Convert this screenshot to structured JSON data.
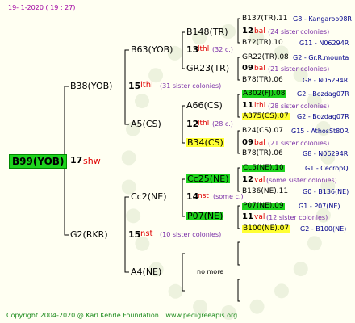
{
  "header": {
    "date": "19-  1-2020  ( 19 : 27)"
  },
  "footer": {
    "copyright": "Copyright 2004-2020 @ Karl Kehrle Foundation",
    "site": "www.pedigreeapis.org"
  },
  "root": {
    "name": "B99(YOB)",
    "gen": "17",
    "origin": "shw"
  },
  "g1": [
    {
      "name": "B38(YOB)",
      "gen": "15",
      "origin": "lthl",
      "note": "(31 sister colonies)"
    },
    {
      "name": "G2(RKR)",
      "gen": "15",
      "origin": "nst",
      "note": "(10 sister colonies)"
    }
  ],
  "g2": [
    {
      "name": "B63(YOB)",
      "gen": "13",
      "origin": "lthl",
      "note": "(32 c.)"
    },
    {
      "name": "A5(CS)",
      "gen": "12",
      "origin": "lthl",
      "note": "(28 c.)"
    },
    {
      "name": "Cc2(NE)",
      "gen": "14",
      "origin": "nst",
      "note": "(some c.)"
    },
    {
      "name": "A4(NE)",
      "more": "no more"
    }
  ],
  "g3": [
    {
      "name": "B148(TR)",
      "gen": "12",
      "origin": "bal",
      "note": "(24 sister colonies)"
    },
    {
      "name": "GR23(TR)",
      "gen": "09",
      "origin": "bal",
      "note": "(21 sister colonies)"
    },
    {
      "name": "A66(CS)",
      "gen": "11",
      "origin": "lthl",
      "note": "(28 sister colonies)"
    },
    {
      "name": "B34(CS)",
      "gen": "09",
      "origin": "bal",
      "note": "(21 sister colonies)"
    },
    {
      "name": "Cc25(NE)",
      "gen": "12",
      "origin": "val",
      "note": "(some sister colonies)"
    },
    {
      "name": "P07(NE)",
      "gen": "11",
      "origin": "val",
      "note": "(12 sister colonies)"
    }
  ],
  "g4": [
    {
      "name": "B137(TR).11",
      "ref": "G8 - Kangaroo98R"
    },
    {
      "name": "B72(TR).10",
      "ref": "G11 - N06294R"
    },
    {
      "name": "GR22(TR).08",
      "ref": "G2 - Gr.R.mounta"
    },
    {
      "name": "B78(TR).06",
      "ref": "G8 - N06294R"
    },
    {
      "name": "A302(FJ).08",
      "ref": "G2 - Bozdag07R"
    },
    {
      "name": "A375(CS).07",
      "ref": "G2 - Bozdag07R"
    },
    {
      "name": "B24(CS).07",
      "ref": "G15 - AthosSt80R"
    },
    {
      "name": "B78(TR).06",
      "ref": "G8 - N06294R"
    },
    {
      "name": "Cc5(NE).10",
      "ref": "G1 - CecropQ"
    },
    {
      "name": "B136(NE).11",
      "ref": "G0 - B136(NE)"
    },
    {
      "name": "P07(NE).09",
      "ref": "G1 - P07(NE)"
    },
    {
      "name": "B100(NE).07",
      "ref": "G2 - B100(NE)"
    }
  ],
  "colors": {
    "green": "#1dd31d",
    "yellow": "#ffff33",
    "red": "#e00000",
    "blue": "#00008b",
    "purple": "#7b2fa8"
  }
}
